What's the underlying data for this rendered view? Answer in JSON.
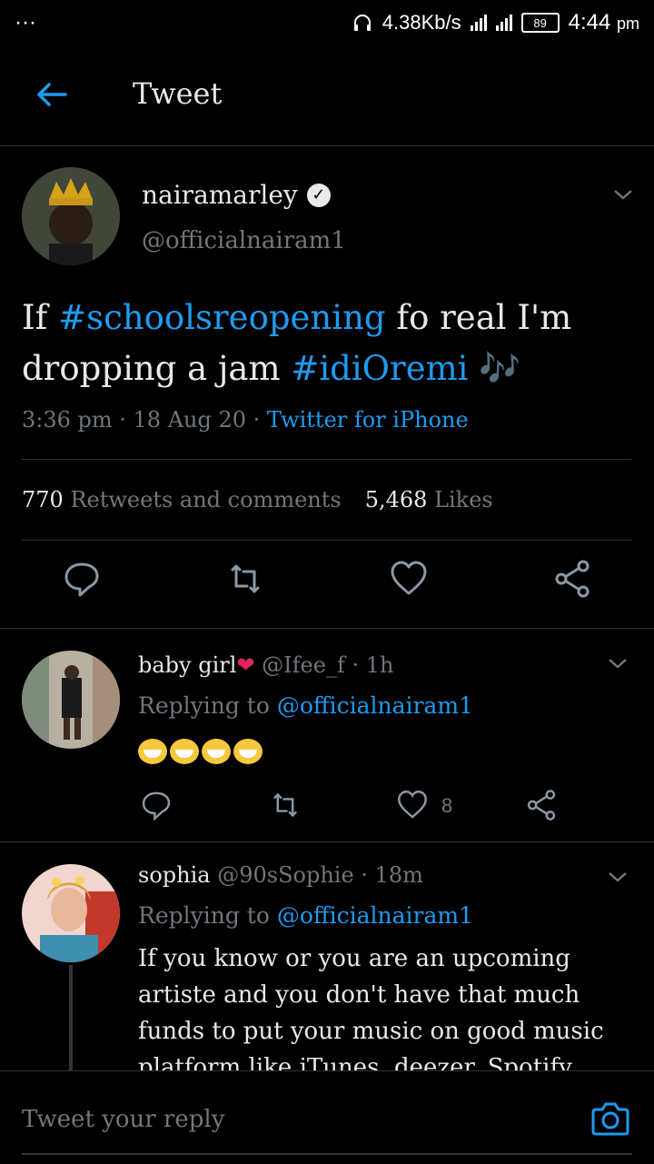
{
  "status_bar": {
    "dots": "···",
    "speed": "4.38Kb/s",
    "battery": "89",
    "time": "4:44",
    "ampm": "pm"
  },
  "header": {
    "title": "Tweet"
  },
  "tweet": {
    "author": "nairamarley",
    "handle": "@officialnairam1",
    "text_parts": [
      "If ",
      "#schoolsreopening",
      " fo real I'm dropping a jam ",
      "#idiOremi",
      " 🎶"
    ],
    "time": "3:36 pm · 18 Aug 20 · ",
    "source": "Twitter for iPhone",
    "retweets_count": "770",
    "retweets_label": "Retweets and comments",
    "likes_count": "5,468",
    "likes_label": "Likes"
  },
  "replies": [
    {
      "name": "baby girl",
      "heart": "❤",
      "handle_time": "@Ifee_f · 1h",
      "replying_label": "Replying to",
      "replying_to": "@officialnairam1",
      "like_count": "8"
    },
    {
      "name": "sophia",
      "handle_time": "@90sSophie · 18m",
      "replying_label": "Replying to",
      "replying_to": "@officialnairam1",
      "body": "If you know or you are an upcoming artiste and you don't have that much funds to put your music on good music platform like iTunes, deezer, Spotify, Shazam etc. DM me I"
    }
  ],
  "composer": {
    "placeholder": "Tweet your reply"
  },
  "colors": {
    "accent": "#1d9bf0",
    "muted": "#71767b",
    "background": "#000000"
  }
}
